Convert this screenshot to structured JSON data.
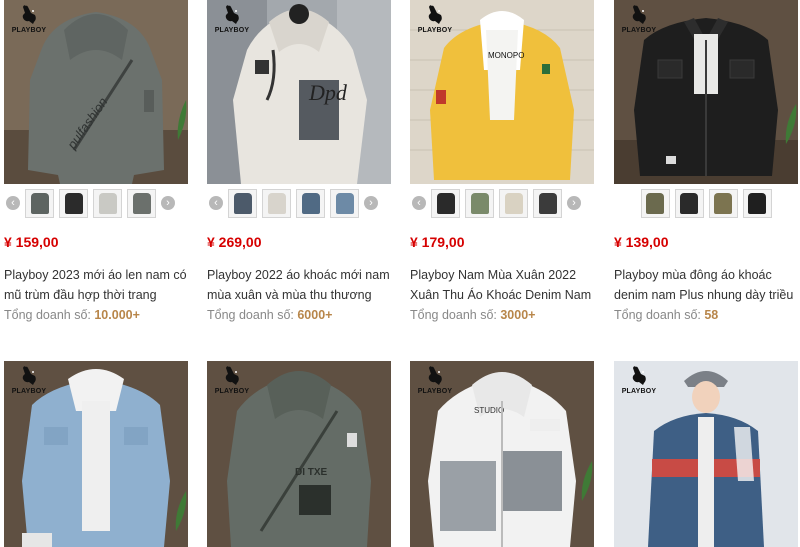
{
  "brand_name": "PLAYBOY",
  "sales_label": "Tổng doanh số:",
  "products": [
    {
      "price": "¥ 159,00",
      "title": "Playboy 2023 mới áo len nam có mũ trùm đầu hợp thời trang",
      "sales": "10.000+",
      "print": "pulfashion",
      "thumb_colors": [
        "#5d6461",
        "#2b2b2b",
        "#c9c9c4",
        "#6b706c"
      ]
    },
    {
      "price": "¥ 269,00",
      "title": "Playboy 2022 áo khoác mới nam mùa xuân và mùa thu thương",
      "sales": "6000+",
      "print": "Dpd",
      "thumb_colors": [
        "#4c5a6a",
        "#d8d4cc",
        "#506a84",
        "#6d8aa6"
      ]
    },
    {
      "price": "¥ 179,00",
      "title": "Playboy Nam Mùa Xuân 2022 Xuân Thu Áo Khoác Denim Nam",
      "sales": "3000+",
      "print": "MONOPO",
      "thumb_colors": [
        "#2a2a2a",
        "#7a8a6a",
        "#d9d2c2",
        "#3b3b3b"
      ]
    },
    {
      "price": "¥ 139,00",
      "title": "Playboy mùa đông áo khoác denim nam Plus nhung dày triều",
      "sales": "58",
      "print": "",
      "thumb_colors": [
        "#6b6a4e",
        "#2a2a2a",
        "#7c7450",
        "#1f1f1f"
      ]
    },
    {
      "print": ""
    },
    {
      "print": "DI TXE"
    },
    {
      "print": "STUDIO"
    },
    {
      "print": ""
    }
  ]
}
